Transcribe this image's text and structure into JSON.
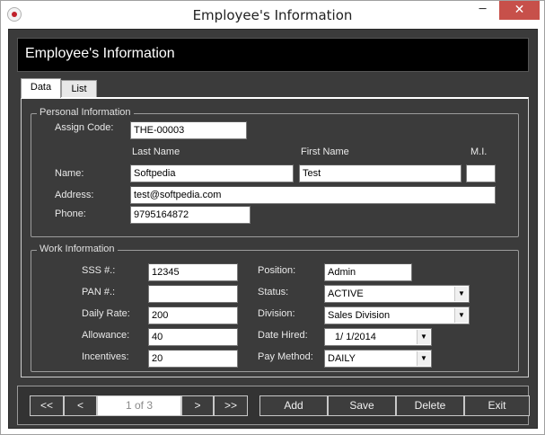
{
  "window": {
    "title": "Employee's Information",
    "minimize_glyph": "─",
    "close_glyph": "✕"
  },
  "header": {
    "title": "Employee's Information"
  },
  "tabs": [
    {
      "label": "Data"
    },
    {
      "label": "List"
    }
  ],
  "personal": {
    "legend": "Personal Information",
    "assign_code_label": "Assign Code:",
    "assign_code_value": "THE-00003",
    "last_name_header": "Last Name",
    "first_name_header": "First Name",
    "mi_header": "M.I.",
    "name_label": "Name:",
    "last_name_value": "Softpedia",
    "first_name_value": "Test",
    "mi_value": "",
    "address_label": "Address:",
    "address_value": "test@softpedia.com",
    "phone_label": "Phone:",
    "phone_value": "9795164872"
  },
  "work": {
    "legend": "Work Information",
    "sss_label": "SSS #.:",
    "sss_value": "12345",
    "pan_label": "PAN #.:",
    "pan_value": "",
    "daily_rate_label": "Daily Rate:",
    "daily_rate_value": "200",
    "allowance_label": "Allowance:",
    "allowance_value": "40",
    "incentives_label": "Incentives:",
    "incentives_value": "20",
    "position_label": "Position:",
    "position_value": "Admin",
    "status_label": "Status:",
    "status_value": "ACTIVE",
    "division_label": "Division:",
    "division_value": "Sales Division",
    "date_hired_label": "Date Hired:",
    "date_hired_value": "1/  1/2014",
    "pay_method_label": "Pay Method:",
    "pay_method_value": "DAILY"
  },
  "nav": {
    "first": "<<",
    "prev": "<",
    "page": "1 of 3",
    "next": ">",
    "last": ">>",
    "add": "Add",
    "save": "Save",
    "delete": "Delete",
    "exit": "Exit"
  },
  "icons": {
    "dropdown": "▼"
  }
}
